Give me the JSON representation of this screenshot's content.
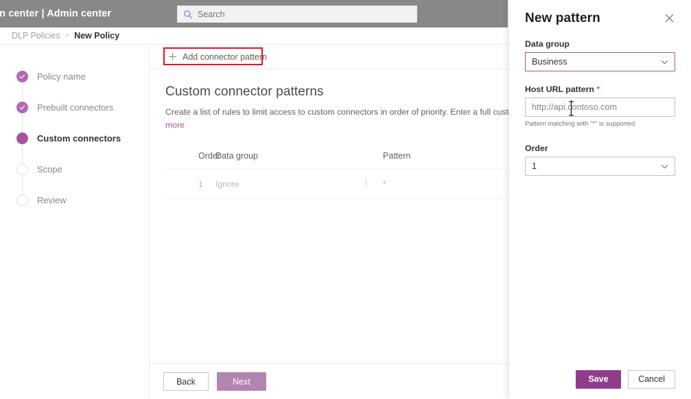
{
  "suite": {
    "title": "min center  |  Admin center",
    "search": {
      "placeholder": "Search",
      "value": "",
      "icon": "search-icon"
    }
  },
  "breadcrumb": {
    "parent": "DLP Policies",
    "separator": ">",
    "current": "New Policy"
  },
  "stepnav": {
    "items": [
      {
        "label": "Policy name",
        "state": "done"
      },
      {
        "label": "Prebuilt connectors",
        "state": "done"
      },
      {
        "label": "Custom connectors",
        "state": "current"
      },
      {
        "label": "Scope",
        "state": "todo"
      },
      {
        "label": "Review",
        "state": "todo"
      }
    ]
  },
  "commandbar": {
    "add_pattern_label": "Add connector pattern",
    "add_pattern_icon": "plus-icon"
  },
  "main": {
    "section_title": "Custom connector patterns",
    "description": "Create a list of rules to limit access to custom connectors in order of priority. Enter a full custom connector U",
    "more_link": "more",
    "table": {
      "columns": [
        "Order",
        "Data group",
        "",
        "Pattern"
      ],
      "rows": [
        {
          "order": "1",
          "data_group": "Ignore",
          "menu": "kebab-menu-icon",
          "pattern": "*"
        }
      ]
    }
  },
  "footer": {
    "back_label": "Back",
    "next_label": "Next"
  },
  "panel": {
    "title": "New pattern",
    "close_icon": "close-icon",
    "data_group": {
      "label": "Data group",
      "value": "Business",
      "chevron": "chevron-down-icon"
    },
    "host_url": {
      "label": "Host URL pattern",
      "required_marker": "*",
      "value": "",
      "placeholder": "http://api.contoso.com",
      "hint": "Pattern matching with \"*\" is supported"
    },
    "order": {
      "label": "Order",
      "value": "1",
      "chevron": "chevron-down-icon"
    },
    "save_label": "Save",
    "cancel_label": "Cancel"
  },
  "colors": {
    "accent": "#a4559e",
    "accent_dark": "#8f3c8c",
    "accent_muted": "#b284b0",
    "suite_bar": "#8a8886",
    "annotation": "#e81123"
  }
}
